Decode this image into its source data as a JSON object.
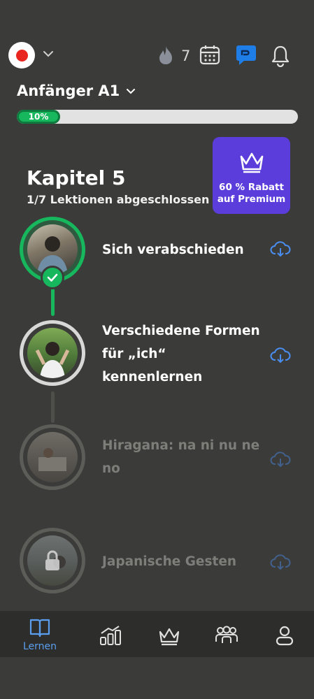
{
  "header": {
    "streak_count": "7",
    "level_label": "Anfänger A1"
  },
  "progress": {
    "percent": 10,
    "label": "10%"
  },
  "chapter": {
    "title": "Kapitel 5",
    "subtitle": "1/7 Lektionen abgeschlossen"
  },
  "promo": {
    "line1": "60 % Rabatt",
    "line2": "auf Premium"
  },
  "lessons": [
    {
      "title": "Sich verabschieden",
      "status": "completed"
    },
    {
      "title_lines": [
        "Verschiedene Formen",
        "für „ich“",
        "kennenlernen"
      ],
      "status": "current"
    },
    {
      "title_lines": [
        "Hiragana: na ni nu ne",
        "no"
      ],
      "status": "locked"
    },
    {
      "title": "Japanische Gesten",
      "status": "locked"
    }
  ],
  "nav": {
    "learn_label": "Lernen"
  },
  "colors": {
    "background": "#3b3c39",
    "accent_green": "#17b85d",
    "accent_blue": "#4a8df0",
    "premium_purple": "#5b3ddb"
  }
}
